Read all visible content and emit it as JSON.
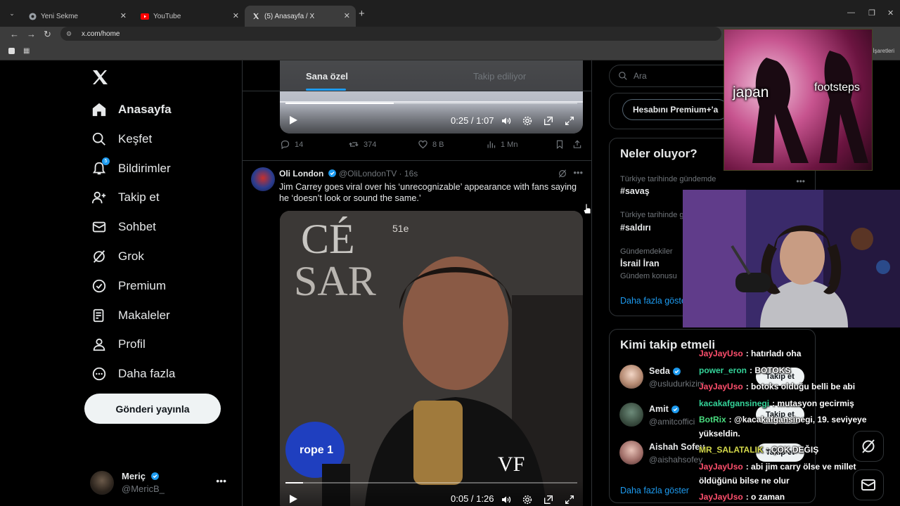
{
  "browser": {
    "tabs": [
      {
        "title": "Yeni Sekme",
        "active": false
      },
      {
        "title": "YouTube",
        "active": false
      },
      {
        "title": "(5) Anasayfa / X",
        "active": true
      }
    ],
    "url": "x.com/home",
    "bookmarks_right": "Tüm Yer İşaretleri"
  },
  "leftnav": {
    "items": [
      {
        "label": "Anasayfa",
        "icon": "home-icon",
        "active": true
      },
      {
        "label": "Keşfet",
        "icon": "search-icon"
      },
      {
        "label": "Bildirimler",
        "icon": "bell-icon",
        "badge": "5"
      },
      {
        "label": "Takip et",
        "icon": "add-person-icon"
      },
      {
        "label": "Sohbet",
        "icon": "mail-icon"
      },
      {
        "label": "Grok",
        "icon": "grok-icon"
      },
      {
        "label": "Premium",
        "icon": "verified-icon"
      },
      {
        "label": "Makaleler",
        "icon": "article-icon"
      },
      {
        "label": "Profil",
        "icon": "person-icon"
      },
      {
        "label": "Daha fazla",
        "icon": "more-circle-icon"
      }
    ],
    "post_button": "Gönderi yayınla",
    "account": {
      "name": "Meriç",
      "handle": "@MericB_"
    }
  },
  "feed": {
    "tabs": {
      "for_you": "Sana özel",
      "following": "Takip ediliyor"
    },
    "video1": {
      "time": "0:25 / 1:07",
      "progress": 0.37
    },
    "post1_actions": {
      "replies": "14",
      "reposts": "374",
      "likes": "8 B",
      "views": "1 Mn"
    },
    "post2": {
      "name": "Oli London",
      "handle": "@OliLondonTV · 16s",
      "text": "Jim Carrey goes viral over his ‘unrecognizable’ appearance with fans saying he ‘doesn’t look or sound the same.’",
      "video_time": "0:05 / 1:26",
      "progress": 0.06
    }
  },
  "sidebar": {
    "search_placeholder": "Ara",
    "premium_button": "Hesabını Premium+'a",
    "trends_title": "Neler oluyor?",
    "trends": [
      {
        "context": "Türkiye tarihinde gündemde",
        "name": "#savaş"
      },
      {
        "context": "Türkiye tarihinde g",
        "name": "#saldırı"
      },
      {
        "context": "Gündemdekiler",
        "name": "İsrail İran",
        "sub": "Gündem konusu"
      }
    ],
    "trends_more": "Daha fazla göster",
    "who_title": "Kimi takip etmeli",
    "who": [
      {
        "name": "Seda",
        "handle": "@usludurkizim"
      },
      {
        "name": "Amit",
        "handle": "@amitcoffici"
      },
      {
        "name": "Aishah Sofey",
        "handle": "@aishahsofey"
      }
    ],
    "follow_label": "Takip et",
    "who_more": "Daha fazla göster"
  },
  "overlay": {
    "meme_left": "japan",
    "meme_right": "footsteps",
    "chat": [
      {
        "user": "JayJayUso",
        "color": "#ff4f6d",
        "msg": ": hatırladı oha"
      },
      {
        "user": "power_eron",
        "color": "#34d399",
        "msg": ": BOTOKS"
      },
      {
        "user": "JayJayUso",
        "color": "#ff4f6d",
        "msg": ": botoks olduğu belli be abi"
      },
      {
        "user": "kacakafgansinegi",
        "color": "#34d399",
        "msg": ": mutasyon gecirmiş"
      },
      {
        "user": "BotRix",
        "color": "#4ade80",
        "msg": ": @kacakafgansinegi, 19. seviyeye"
      },
      {
        "user": "",
        "color": "#ffffff",
        "msg": "yükseldin."
      },
      {
        "user": "MR_SALATALIK",
        "color": "#d4d94a",
        "msg": ": ÇOK DEĞIŞ"
      },
      {
        "user": "JayJayUso",
        "color": "#ff4f6d",
        "msg": ": abi jim carry ölse ve millet"
      },
      {
        "user": "",
        "color": "#ffffff",
        "msg": "öldüğünü bilse ne olur"
      },
      {
        "user": "JayJayUso",
        "color": "#ff4f6d",
        "msg": ": o zaman"
      }
    ]
  }
}
